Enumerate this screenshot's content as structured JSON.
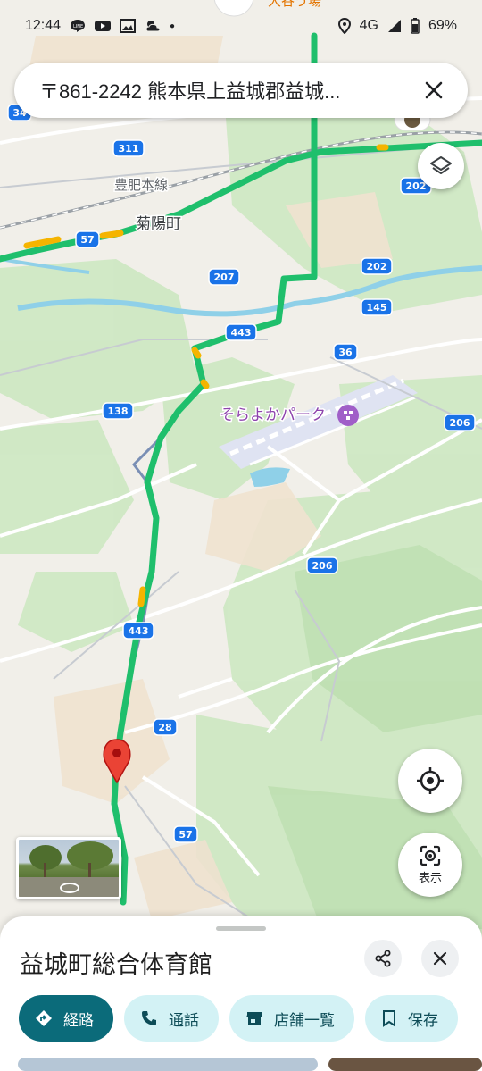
{
  "status_bar": {
    "time": "12:44",
    "network": "4G",
    "battery": "69%"
  },
  "search": {
    "query": "〒861-2242 熊本県上益城郡益城..."
  },
  "map": {
    "line_label": "豊肥本線",
    "town_label": "菊陽町",
    "poi_label": "そらよかパーク",
    "route_badges": [
      "34",
      "311",
      "202",
      "57",
      "207",
      "202",
      "145",
      "443",
      "36",
      "138",
      "206",
      "206",
      "443",
      "28",
      "57"
    ]
  },
  "buttons": {
    "display_label": "表示"
  },
  "sheet": {
    "title": "益城町総合体育館",
    "chips": [
      {
        "label": "経路",
        "icon": "directions-icon"
      },
      {
        "label": "通話",
        "icon": "phone-icon"
      },
      {
        "label": "店舗一覧",
        "icon": "store-icon"
      },
      {
        "label": "保存",
        "icon": "bookmark-icon"
      }
    ]
  },
  "colors": {
    "traffic_green": "#1fbf6c",
    "traffic_yellow": "#f5b400",
    "highway_blue": "#1a73e8",
    "pin_red": "#ea4335",
    "primary_chip": "#0b6b7a",
    "chip_bg": "#d3f2f5"
  }
}
